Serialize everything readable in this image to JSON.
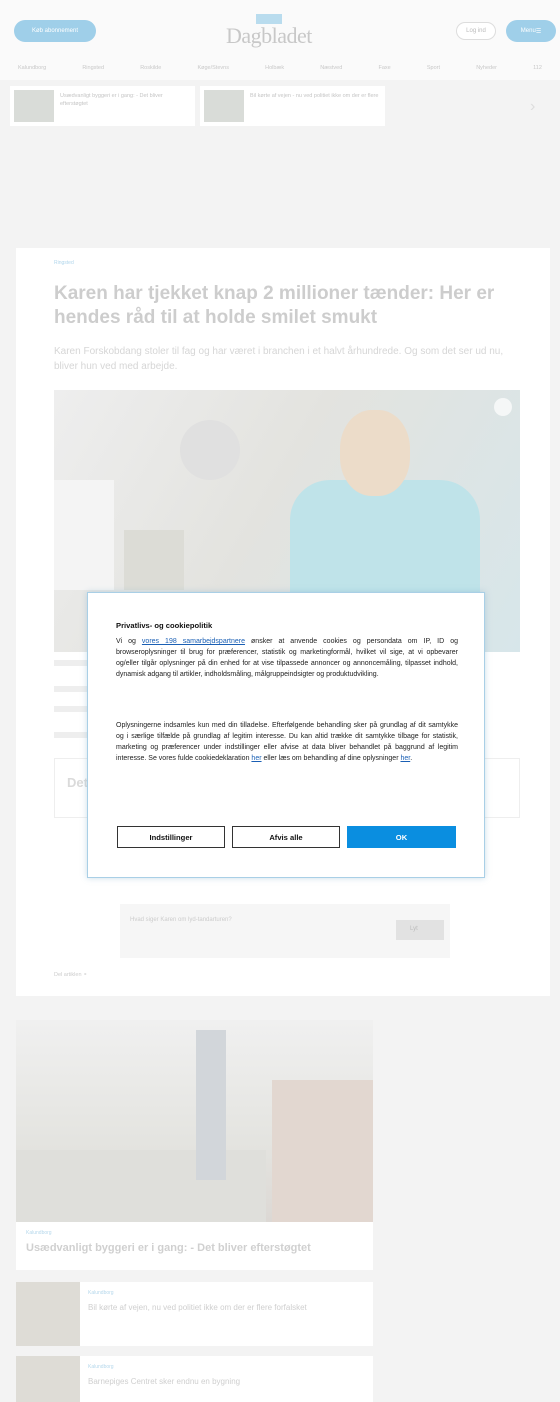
{
  "header": {
    "subscribe_label": "Køb abonnement",
    "logo_text": "Dagbladet",
    "login_label": "Log ind",
    "menu_label": "Menu"
  },
  "nav": {
    "items": [
      "Kalundborg",
      "Ringsted",
      "Roskilde",
      "Køge/Stevns",
      "Holbæk",
      "Næstved",
      "Faxe",
      "Sport",
      "Nyheder",
      "112"
    ]
  },
  "teasers": [
    {
      "text": "Usædvanligt byggeri er i gang: - Det bliver efterstøgtet"
    },
    {
      "text": "Bil kørte af vejen - nu ved politiet ikke om der er flere"
    }
  ],
  "article": {
    "kicker": "Ringsted",
    "headline": "Karen har tjekket knap 2 millioner tænder: Her er hendes råd til at holde smilet smukt",
    "lead": "Karen Forskobdang stoler til fag og har været i branchen i et halvt århundrede. Og som det ser ud nu, bliver hun ved med arbejde.",
    "info_box_title": "Det",
    "audio_text": "Hvad siger Karen om lyd-tandarturen?",
    "audio_button": "Lyt",
    "share_label": "Del artiklen"
  },
  "cards": {
    "big": {
      "tag": "Kalundborg",
      "title": "Usædvanligt byggeri er i gang: - Det bliver efterstøgtet"
    },
    "small": [
      {
        "tag": "Kalundborg",
        "title": "Bil kørte af vejen, nu ved politiet ikke om der er flere forfalsket"
      },
      {
        "tag": "Kalundborg",
        "title": "Barnepiges Centret sker endnu en bygning"
      }
    ]
  },
  "consent": {
    "title": "Privatlivs- og cookiepolitik",
    "p1_prefix": "Vi og ",
    "p1_link": "vores 198 samarbejdspartnere",
    "p1_rest": " ønsker at anvende cookies og persondata om IP, ID og browseroplysninger til brug for præferencer, statistik og marketingformål, hvilket vil sige, at vi opbevarer og/eller tilgår oplysninger på din enhed for at vise tilpassede annoncer og annoncemåling, tilpasset indhold, dynamisk adgang til artikler, indholdsmåling, målgruppeindsigter og produktudvikling.",
    "p2_text": "Oplysningerne indsamles kun med din tilladelse. Efterfølgende behandling sker på grundlag af dit samtykke og i særlige tilfælde på grundlag af legitim interesse. Du kan altid trække dit samtykke tilbage for statistik, marketing og præferencer under indstillinger eller afvise at data bliver behandlet på baggrund af legitim interesse. Se vores fulde cookiedeklaration ",
    "p2_link1": "her",
    "p2_mid": " eller læs om behandling af dine oplysninger ",
    "p2_link2": "her",
    "p2_end": ".",
    "settings_label": "Indstillinger",
    "reject_label": "Afvis alle",
    "ok_label": "OK"
  },
  "colors": {
    "accent": "#0a8ee0",
    "dialog_border": "#a9cfe6"
  }
}
